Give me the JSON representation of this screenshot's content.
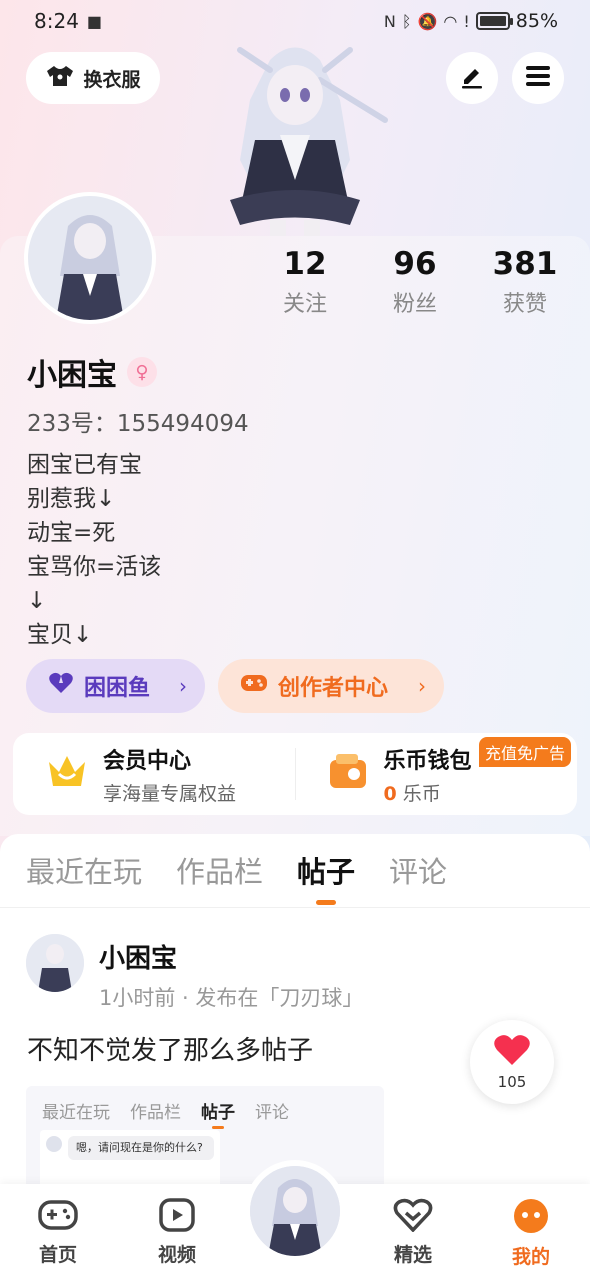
{
  "status_bar": {
    "time": "8:24",
    "battery": "85%",
    "battery_level": 0.85
  },
  "header": {
    "outfit_label": "换衣服",
    "edit_icon": "pen-icon",
    "menu_icon": "menu-icon"
  },
  "profile": {
    "username": "小困宝",
    "gender_symbol": "♀",
    "uid": "233号：155494094",
    "bio": [
      "困宝已有宝",
      "别惹我↓",
      "动宝=死",
      "宝骂你=活该",
      "↓",
      "宝贝↓"
    ],
    "stats": [
      {
        "value": "12",
        "label": "关注"
      },
      {
        "value": "96",
        "label": "粉丝"
      },
      {
        "value": "381",
        "label": "获赞"
      }
    ]
  },
  "chips": {
    "fish_label": "困困鱼",
    "creator_label": "创作者中心"
  },
  "wallet": {
    "vip_title": "会员中心",
    "vip_sub": "享海量专属权益",
    "coin_title": "乐币钱包",
    "coin_amount": "0",
    "coin_unit": "乐币",
    "promo_tag": "充值免广告"
  },
  "tabs": [
    "最近在玩",
    "作品栏",
    "帖子",
    "评论"
  ],
  "active_tab": "帖子",
  "post": {
    "author": "小困宝",
    "meta": "1小时前 · 发布在「刀刃球」",
    "text": "不知不觉发了那么多帖子",
    "like_count": "105",
    "preview": {
      "tabs": [
        "最近在玩",
        "作品栏",
        "帖子",
        "评论"
      ],
      "bubble_text": "嗯，请问现在是你的什么?"
    }
  },
  "bottom_nav": [
    {
      "label": "首页",
      "icon": "gamepad-icon"
    },
    {
      "label": "视频",
      "icon": "video-play-icon"
    },
    {
      "label": "精选",
      "icon": "heart-badge-icon"
    },
    {
      "label": "我的",
      "icon": "profile-dots-icon"
    }
  ],
  "colors": {
    "accent": "#f47b1c",
    "purple": "#5a3bbd",
    "pink": "#f06f95"
  }
}
